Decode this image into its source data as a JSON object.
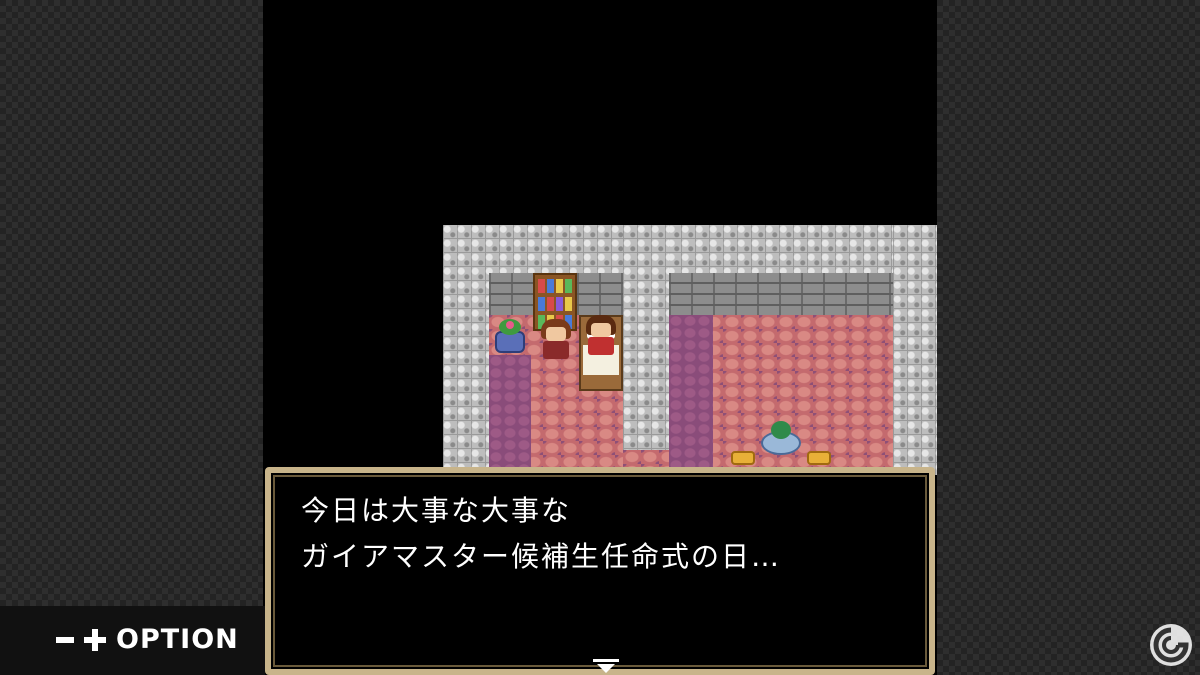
{
  "dialogue": {
    "line1": "今日は大事な大事な",
    "line2": "ガイアマスター候補生任命式の日…"
  },
  "option_hint": {
    "label": "OPTION",
    "minus_icon": "minus-icon",
    "plus_icon": "plus-icon"
  },
  "colors": {
    "dialogue_border": "#c8b48a",
    "floor": "#c46a6e",
    "stone_wall": "#bdbdbd"
  },
  "watermark": {
    "icon": "site-logo-watermark"
  }
}
